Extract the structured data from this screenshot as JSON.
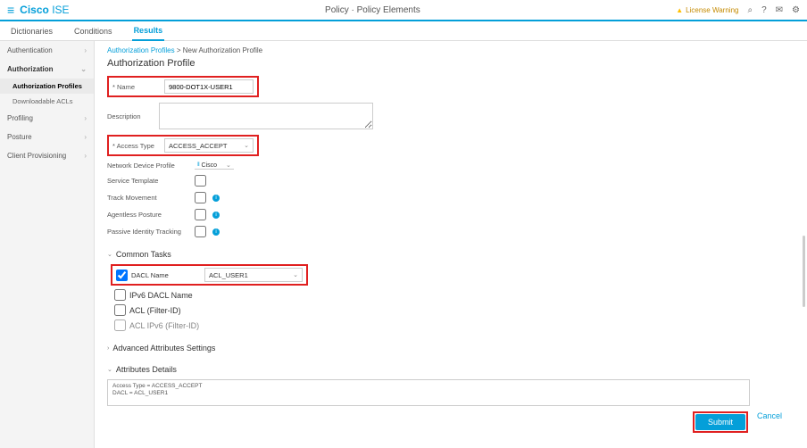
{
  "header": {
    "brand_bold": "Cisco",
    "brand_light": " ISE",
    "page_title": "Policy · Policy Elements",
    "warning": "License Warning"
  },
  "tabs": {
    "dictionaries": "Dictionaries",
    "conditions": "Conditions",
    "results": "Results"
  },
  "sidebar": {
    "authentication": "Authentication",
    "authorization": "Authorization",
    "authz_profiles": "Authorization Profiles",
    "downloadable_acls": "Downloadable ACLs",
    "profiling": "Profiling",
    "posture": "Posture",
    "client_prov": "Client Provisioning"
  },
  "breadcrumb": {
    "parent": "Authorization Profiles",
    "current": "New Authorization Profile"
  },
  "form": {
    "title": "Authorization Profile",
    "name_label": "* Name",
    "name_value": "9800-DOT1X-USER1",
    "desc_label": "Description",
    "access_label": "* Access Type",
    "access_value": "ACCESS_ACCEPT",
    "ndp_label": "Network Device Profile",
    "ndp_value": "Cisco",
    "svc_tmpl_label": "Service Template",
    "track_label": "Track Movement",
    "agentless_label": "Agentless Posture",
    "passive_label": "Passive Identity Tracking"
  },
  "common_tasks": {
    "heading": "Common Tasks",
    "dacl_label": "DACL Name",
    "dacl_value": "ACL_USER1",
    "ipv6_dacl": "IPv6 DACL Name",
    "acl_filter": "ACL (Filter-ID)",
    "acl_ipv6": "ACL IPv6 (Filter-ID)"
  },
  "adv_attrs": {
    "heading": "Advanced Attributes Settings"
  },
  "attr_details": {
    "heading": "Attributes Details",
    "line1": "Access Type = ACCESS_ACCEPT",
    "line2": "DACL = ACL_USER1"
  },
  "footer": {
    "submit": "Submit",
    "cancel": "Cancel"
  }
}
